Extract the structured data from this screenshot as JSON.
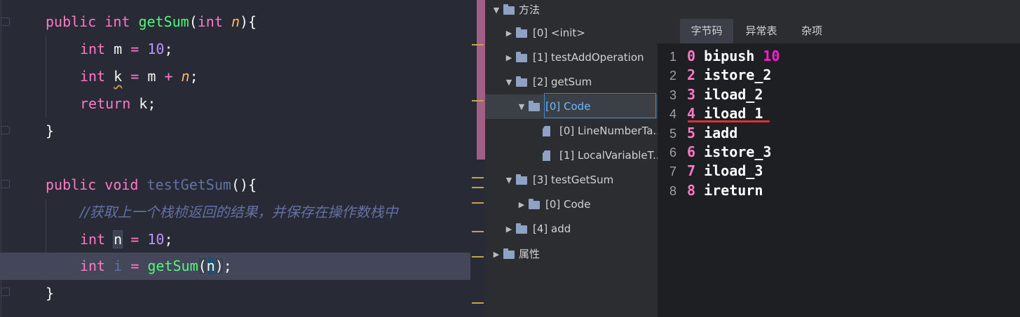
{
  "editor": {
    "lines": [
      {
        "tokens": [
          [
            "kw",
            "public"
          ],
          [
            "",
            " "
          ],
          [
            "kw",
            "int"
          ],
          [
            "",
            " "
          ],
          [
            "fn",
            "getSum"
          ],
          [
            "",
            "("
          ],
          [
            "kw",
            "int"
          ],
          [
            "",
            " "
          ],
          [
            "par",
            "n"
          ],
          [
            "",
            "){"
          ]
        ]
      },
      {
        "tokens": [
          [
            "kw",
            "int"
          ],
          [
            "",
            " m "
          ],
          [
            "op",
            "="
          ],
          [
            "",
            " "
          ],
          [
            "num",
            "10"
          ],
          [
            "",
            ";"
          ]
        ]
      },
      {
        "tokens": [
          [
            "kw",
            "int"
          ],
          [
            "",
            " "
          ],
          [
            "warn",
            "k"
          ],
          [
            "",
            " "
          ],
          [
            "op",
            "="
          ],
          [
            "",
            " m "
          ],
          [
            "op",
            "+"
          ],
          [
            "",
            " "
          ],
          [
            "par",
            "n"
          ],
          [
            "",
            ";"
          ]
        ]
      },
      {
        "tokens": [
          [
            "kw",
            "return"
          ],
          [
            "",
            " k;"
          ]
        ]
      },
      {
        "tokens": [
          [
            "",
            "}"
          ]
        ]
      },
      {
        "tokens": []
      },
      {
        "tokens": [
          [
            "kw",
            "public"
          ],
          [
            "",
            " "
          ],
          [
            "kw",
            "void"
          ],
          [
            "",
            " "
          ],
          [
            "unused",
            "testGetSum"
          ],
          [
            "",
            "(){"
          ]
        ]
      },
      {
        "tokens": [
          [
            "cm",
            "//获取上一个栈桢返回的结果，并保存在操作数栈中"
          ]
        ]
      },
      {
        "tokens": [
          [
            "kw",
            "int"
          ],
          [
            "",
            " "
          ],
          [
            "sel",
            "n"
          ],
          [
            "",
            " "
          ],
          [
            "op",
            "="
          ],
          [
            "",
            " "
          ],
          [
            "num",
            "10"
          ],
          [
            "",
            ";"
          ]
        ]
      },
      {
        "tokens": [
          [
            "kw",
            "int"
          ],
          [
            "",
            " "
          ],
          [
            "unused",
            "i"
          ],
          [
            "",
            " "
          ],
          [
            "op",
            "="
          ],
          [
            "",
            " "
          ],
          [
            "fn",
            "getSum"
          ],
          [
            "sel",
            "("
          ],
          [
            "brace",
            "n"
          ],
          [
            "sel",
            ")"
          ],
          [
            "",
            ";"
          ]
        ]
      },
      {
        "tokens": [
          [
            "",
            "}"
          ]
        ]
      }
    ]
  },
  "tree": {
    "rows": [
      {
        "label": "方法",
        "arrow": "▼",
        "icon": "folder"
      },
      {
        "label": "[0] <init>",
        "arrow": "▶",
        "icon": "folder"
      },
      {
        "label": "[1] testAddOperation",
        "arrow": "▶",
        "icon": "folder"
      },
      {
        "label": "[2] getSum",
        "arrow": "▼",
        "icon": "folder"
      },
      {
        "label": "[0] Code",
        "arrow": "▼",
        "icon": "folder",
        "selected": true
      },
      {
        "label": "[0] LineNumberTa...",
        "arrow": "",
        "icon": "file"
      },
      {
        "label": "[1] LocalVariableT...",
        "arrow": "",
        "icon": "file"
      },
      {
        "label": "[3] testGetSum",
        "arrow": "▼",
        "icon": "folder"
      },
      {
        "label": "[0] Code",
        "arrow": "▶",
        "icon": "folder"
      },
      {
        "label": "[4] add",
        "arrow": "▶",
        "icon": "folder"
      },
      {
        "label": "属性",
        "arrow": "▶",
        "icon": "folder"
      }
    ]
  },
  "bytecode": {
    "tabs": [
      "字节码",
      "异常表",
      "杂项"
    ],
    "active_tab": "字节码",
    "lines": [
      {
        "ln": "1",
        "offset": "0",
        "op": "bipush",
        "arg": "10"
      },
      {
        "ln": "2",
        "offset": "2",
        "op": "istore_2",
        "arg": ""
      },
      {
        "ln": "3",
        "offset": "3",
        "op": "iload_2",
        "arg": ""
      },
      {
        "ln": "4",
        "offset": "4",
        "op": "iload_1",
        "arg": ""
      },
      {
        "ln": "5",
        "offset": "5",
        "op": "iadd",
        "arg": ""
      },
      {
        "ln": "6",
        "offset": "6",
        "op": "istore_3",
        "arg": ""
      },
      {
        "ln": "7",
        "offset": "7",
        "op": "iload_3",
        "arg": ""
      },
      {
        "ln": "8",
        "offset": "8",
        "op": "ireturn",
        "arg": ""
      }
    ]
  },
  "colors": {
    "editor_bg": "#282a36",
    "keyword": "#ff79c6",
    "function": "#50fa7b",
    "number": "#bd93f9",
    "param": "#ffb86c",
    "comment": "#6272a4",
    "highlight": "#e0322b"
  }
}
